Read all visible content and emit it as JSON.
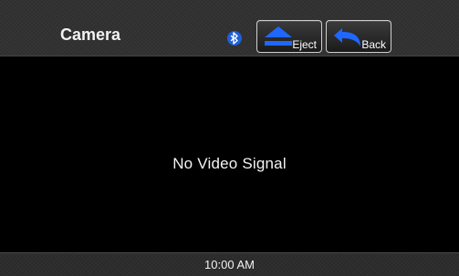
{
  "header": {
    "title": "Camera",
    "bluetooth_icon": "bluetooth-icon",
    "buttons": {
      "eject_label": "Eject",
      "back_label": "Back"
    }
  },
  "main": {
    "message": "No Video Signal"
  },
  "footer": {
    "time": "10:00 AM"
  },
  "colors": {
    "bluetooth_blue": "#1f5fd8",
    "button_icon_blue": "#1f67ff",
    "background": "#000000",
    "bar_background": "#2f2f2f"
  }
}
